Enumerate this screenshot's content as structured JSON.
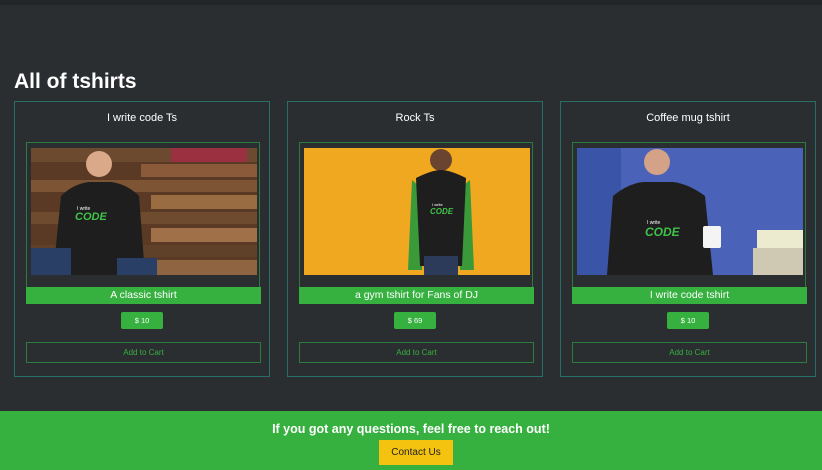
{
  "page": {
    "title": "All of tshirts"
  },
  "products": [
    {
      "name": "I write code Ts",
      "description": "A classic tshirt",
      "price": "$ 10",
      "cta": "Add to Cart"
    },
    {
      "name": "Rock Ts",
      "description": "a gym tshirt for Fans of DJ",
      "price": "$ 69",
      "cta": "Add to Cart"
    },
    {
      "name": "Coffee mug tshirt",
      "description": "I write code tshirt",
      "price": "$ 10",
      "cta": "Add to Cart"
    }
  ],
  "shirt_print": {
    "line1": "I write",
    "line2": "CODE"
  },
  "footer": {
    "message": "If you got any questions, feel free to reach out!",
    "button": "Contact Us"
  },
  "colors": {
    "background": "#2b2e31",
    "accent_green": "#36b03f",
    "card_border": "#2a6e6a",
    "contact_yellow": "#f4c30f"
  }
}
